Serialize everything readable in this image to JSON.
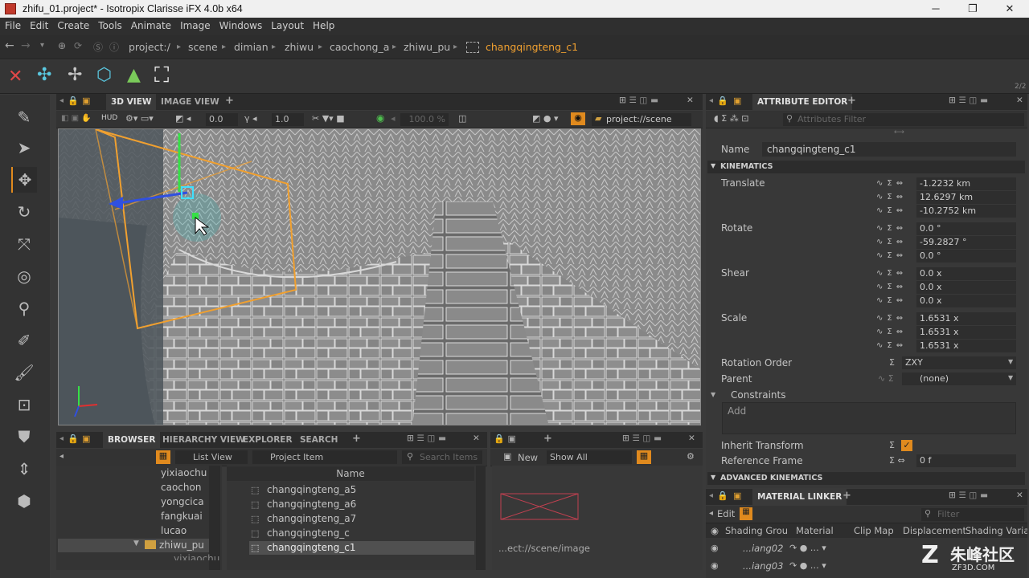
{
  "window": {
    "title": "zhifu_01.project* - Isotropix Clarisse iFX 4.0b x64",
    "min": "─",
    "max": "❐",
    "close": "✕"
  },
  "menu": [
    "File",
    "Edit",
    "Create",
    "Tools",
    "Animate",
    "Image",
    "Windows",
    "Layout",
    "Help"
  ],
  "path": {
    "crumbs": [
      "project:/",
      "scene",
      "dimian",
      "zhiwu",
      "caochong_a",
      "zhiwu_pu"
    ],
    "current": "changqingteng_c1"
  },
  "viewport": {
    "tabs": [
      "3D VIEW",
      "IMAGE VIEW"
    ],
    "hud": "HUD",
    "field1": "0.0",
    "field2": "1.0",
    "zoom": "100.0 %",
    "context": "project://scene"
  },
  "attr": {
    "tab": "ATTRIBUTE EDITOR",
    "filter_placeholder": "Attributes Filter",
    "name_label": "Name",
    "name_value": "changqingteng_c1",
    "kinematics": "KINEMATICS",
    "translate_label": "Translate",
    "translate": [
      "-1.2232 km",
      "12.6297 km",
      "-10.2752 km"
    ],
    "rotate_label": "Rotate",
    "rotate": [
      "0.0 °",
      "-59.2827 °",
      "0.0 °"
    ],
    "shear_label": "Shear",
    "shear": [
      "0.0 x",
      "0.0 x",
      "0.0 x"
    ],
    "scale_label": "Scale",
    "scale": [
      "1.6531 x",
      "1.6531 x",
      "1.6531 x"
    ],
    "rot_order_label": "Rotation Order",
    "rot_order": "ZXY",
    "parent_label": "Parent",
    "parent": "(none)",
    "constraints_label": "Constraints",
    "add": "Add",
    "inherit_label": "Inherit Transform",
    "ref_frame_label": "Reference Frame",
    "ref_frame": "0 f",
    "advanced": "ADVANCED KINEMATICS",
    "page": "2/2"
  },
  "browser": {
    "tabs": [
      "BROWSER",
      "HIERARCHY VIEW",
      "EXPLORER",
      "SEARCH"
    ],
    "view_mode": "List View",
    "type_filter": "Project Item",
    "search_placeholder": "Search Items",
    "tree": [
      "yixiaochu",
      "caochon",
      "yongcica",
      "fangkuai",
      "lucao",
      "zhiwu_pu",
      "yixiaochu"
    ],
    "column": "Name",
    "items": [
      "changqingteng_a5",
      "changqingteng_a6",
      "changqingteng_a7",
      "changqingteng_c",
      "changqingteng_c1"
    ]
  },
  "preview": {
    "new": "New",
    "show": "Show All",
    "path": "...ect://scene/image"
  },
  "material": {
    "tab": "MATERIAL LINKER",
    "edit": "Edit",
    "filter_placeholder": "Filter",
    "columns": [
      "Shading Group",
      "Material",
      "Clip Map",
      "Displacement",
      "Shading Variab"
    ],
    "rows": [
      "...iang02",
      "...iang03"
    ]
  },
  "watermark": {
    "brand": "朱峰社区",
    "site": "ZF3D.COM"
  },
  "colors": {
    "accent": "#e08a1e",
    "selection": "#f0a030",
    "background": "#3a3a3a"
  }
}
